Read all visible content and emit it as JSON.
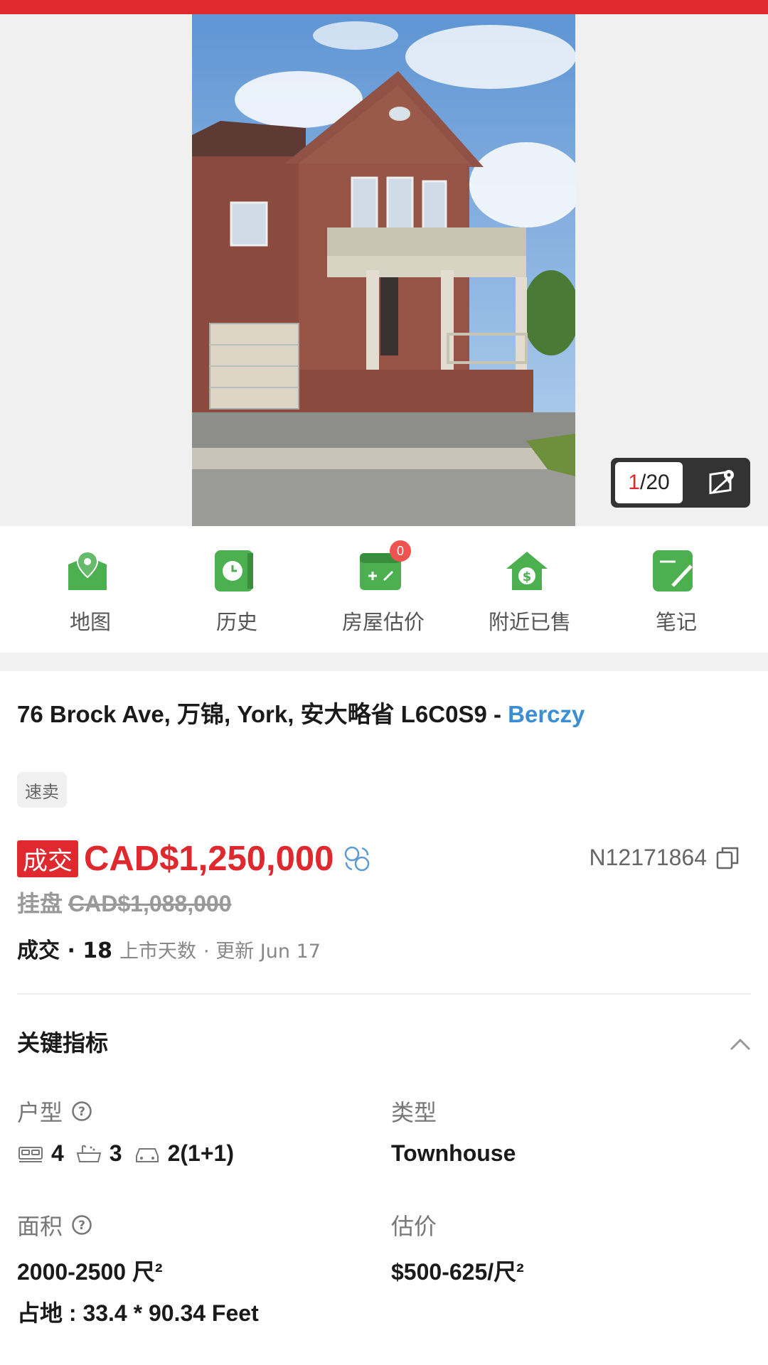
{
  "photo": {
    "current": "1",
    "total": "/20"
  },
  "actions": [
    {
      "label": "地图",
      "icon": "map-pin-icon"
    },
    {
      "label": "历史",
      "icon": "clock-icon"
    },
    {
      "label": "房屋估价",
      "icon": "calculator-icon",
      "badge": "0"
    },
    {
      "label": "附近已售",
      "icon": "house-dollar-icon"
    },
    {
      "label": "笔记",
      "icon": "note-pencil-icon"
    }
  ],
  "address": {
    "main": "76 Brock Ave, 万锦, York, 安大略省 L6C0S9 - ",
    "community": "Berczy"
  },
  "tag": "速卖",
  "price": {
    "status_badge": "成交",
    "sold_price": "CAD$1,250,000",
    "mls": "N12171864",
    "list_label": "挂盘",
    "list_price": "CAD$1,088,000"
  },
  "status": {
    "state": "成交 · 18",
    "days_label": "上市天数",
    "updated": "· 更新 Jun 17"
  },
  "key_metrics": {
    "title": "关键指标",
    "layout_label": "户型",
    "beds": "4",
    "baths": "3",
    "parking": "2(1+1)",
    "type_label": "类型",
    "type_value": "Townhouse",
    "area_label": "面积",
    "area_value": "2000-2500 尺²",
    "lot_value": "占地 : 33.4 * 90.34 Feet",
    "estimate_label": "估价",
    "estimate_value": "$500-625/尺²"
  },
  "colors": {
    "accent_red": "#e0282f",
    "link_blue": "#3a8ed6",
    "icon_green": "#4caf50"
  }
}
